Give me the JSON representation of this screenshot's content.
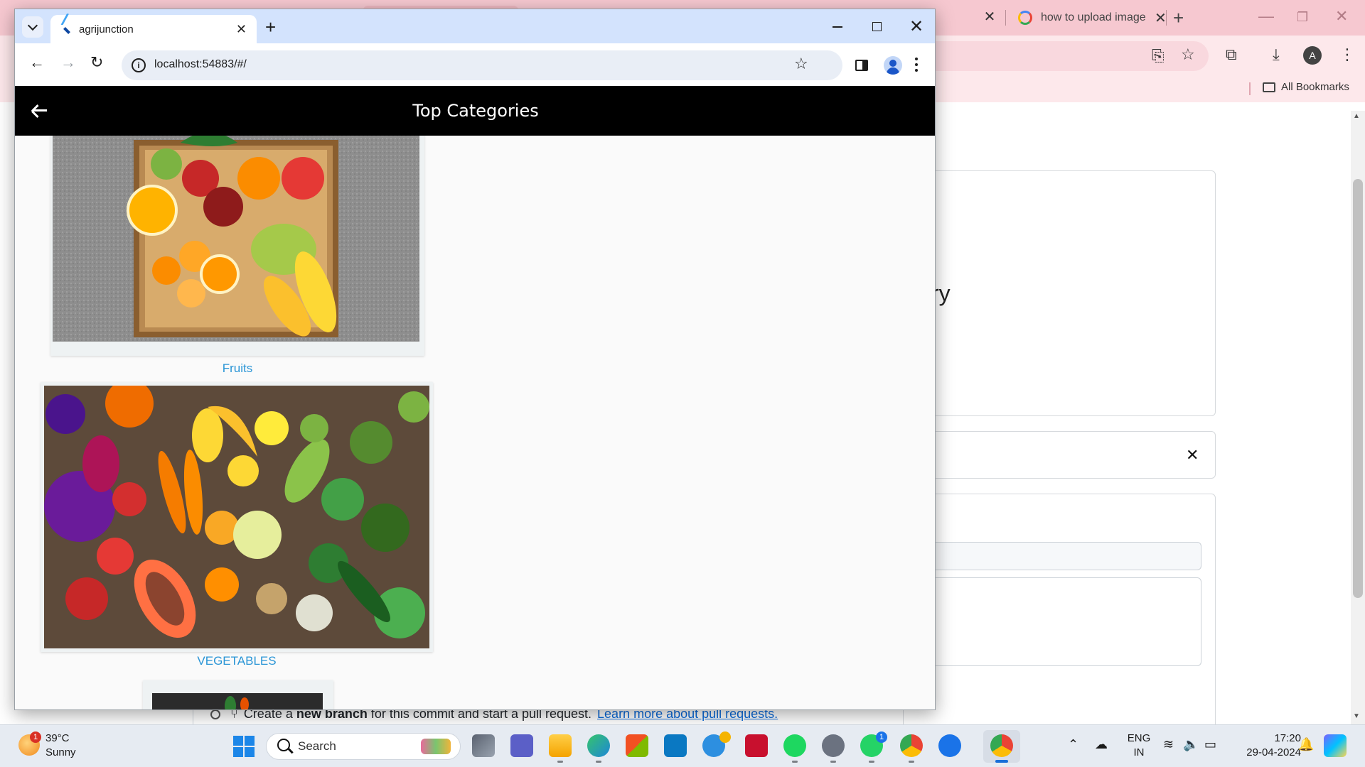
{
  "background_browser": {
    "tab2_title": "how to upload image",
    "new_tab_symbol": "+",
    "close_symbol": "✕",
    "bookmarks_label": "All Bookmarks",
    "avatar_letter": "A",
    "page_fragment_text": "ry",
    "dismiss_symbol": "✕",
    "commit_text_pre": "Create a ",
    "commit_text_bold": "new branch",
    "commit_text_post": " for this commit and start a pull request.",
    "commit_link": "Learn more about pull requests."
  },
  "browser": {
    "tab_title": "agrijunction",
    "tab_close": "✕",
    "new_tab": "+",
    "url": "localhost:54883/#/",
    "info_glyph": "i",
    "star_glyph": "☆"
  },
  "app": {
    "title": "Top Categories",
    "categories": [
      {
        "label": "Fruits",
        "image": "fruits-crate-photo"
      },
      {
        "label": "VEGETABLES",
        "image": "vegetables-assortment-photo"
      },
      {
        "label": "",
        "image": "partial-category-photo"
      }
    ]
  },
  "taskbar": {
    "weather_temp": "39°C",
    "weather_desc": "Sunny",
    "weather_badge": "1",
    "search_placeholder": "Search",
    "whatsapp_badge": "1",
    "language_top": "ENG",
    "language_bottom": "IN",
    "time": "17:20",
    "date": "29-04-2024"
  },
  "colors": {
    "app_bar": "#000000",
    "category_label": "#2a95d6",
    "chrome_fg_titlebar": "#d3e3fd",
    "chrome_bg_titlebar": "#f6c8d0"
  }
}
